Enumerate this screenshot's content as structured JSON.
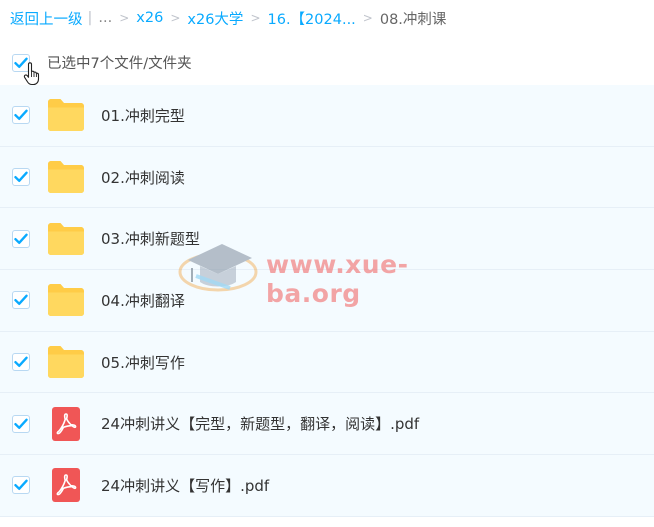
{
  "breadcrumb": {
    "back_label": "返回上一级",
    "ellipsis": "...",
    "items": [
      "x26",
      "x26大学",
      "16.【2024..."
    ],
    "current": "08.冲刺课"
  },
  "selection": {
    "label": "已选中7个文件/文件夹"
  },
  "files": [
    {
      "name": "01.冲刺完型",
      "type": "folder"
    },
    {
      "name": "02.冲刺阅读",
      "type": "folder"
    },
    {
      "name": "03.冲刺新题型",
      "type": "folder"
    },
    {
      "name": "04.冲刺翻译",
      "type": "folder"
    },
    {
      "name": "05.冲刺写作",
      "type": "folder"
    },
    {
      "name": "24冲刺讲义【完型，新题型，翻译，阅读】.pdf",
      "type": "pdf"
    },
    {
      "name": "24冲刺讲义【写作】.pdf",
      "type": "pdf"
    }
  ],
  "watermark": {
    "text": "www.xue-ba.org"
  },
  "colors": {
    "link": "#09aaff",
    "row_bg": "#f4fbff",
    "folder": "#ffd04f",
    "pdf": "#f05656",
    "check": "#09aaff"
  }
}
